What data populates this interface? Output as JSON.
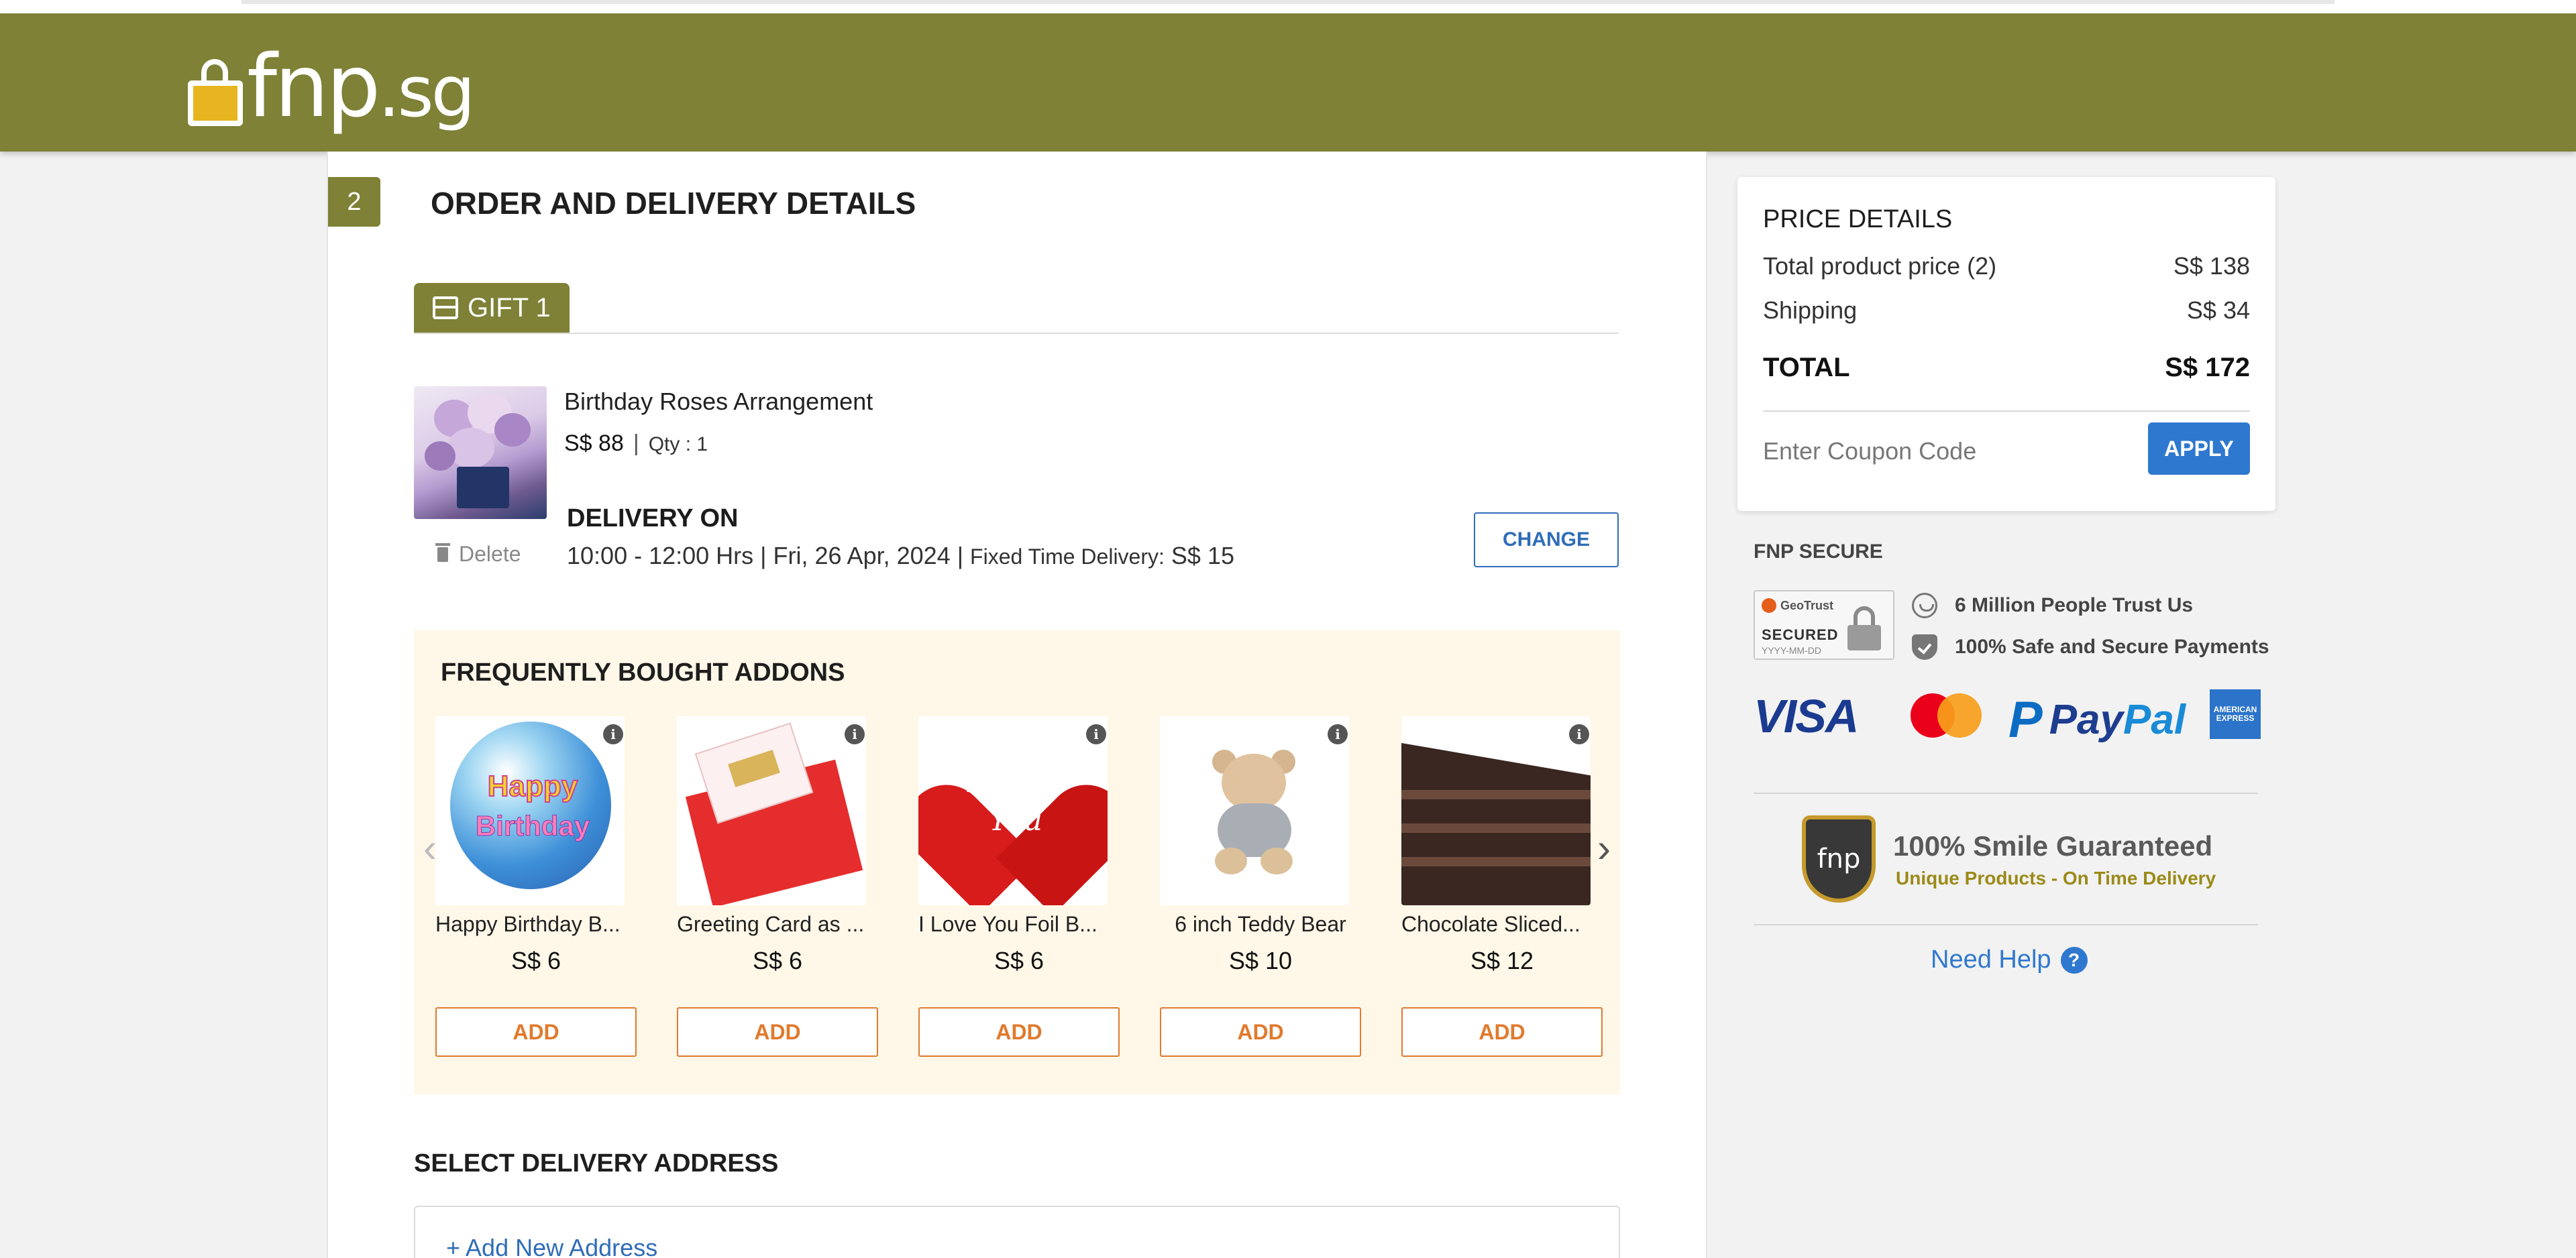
{
  "brand": {
    "logo_text": "fnp",
    "logo_suffix": ".sg",
    "header_color": "#7e8136"
  },
  "order": {
    "step_number": "2",
    "section_title": "ORDER AND DELIVERY DETAILS",
    "gift_tab_label": "GIFT 1",
    "product": {
      "name": "Birthday Roses Arrangement",
      "price": "S$ 88",
      "qty": "Qty : 1",
      "delete_label": "Delete"
    },
    "delivery": {
      "title": "DELIVERY ON",
      "slot": "10:00 - 12:00 Hrs",
      "date": "Fri, 26 Apr, 2024",
      "type_label": "Fixed Time Delivery:",
      "fee": "S$ 15",
      "change_label": "CHANGE"
    }
  },
  "addons": {
    "title": "FREQUENTLY BOUGHT ADDONS",
    "add_label": "ADD",
    "items": [
      {
        "name": "Happy Birthday B...",
        "price": "S$ 6"
      },
      {
        "name": "Greeting Card as ...",
        "price": "S$ 6"
      },
      {
        "name": "I Love You Foil B...",
        "price": "S$ 6"
      },
      {
        "name": "6 inch Teddy Bear",
        "price": "S$ 10"
      },
      {
        "name": "Chocolate Sliced...",
        "price": "S$ 12"
      }
    ]
  },
  "address": {
    "title": "SELECT DELIVERY ADDRESS",
    "add_new": "+ Add New Address"
  },
  "price_details": {
    "title": "PRICE DETAILS",
    "total_product_label": "Total product price (2)",
    "total_product_value": "S$ 138",
    "shipping_label": "Shipping",
    "shipping_value": "S$ 34",
    "total_label": "TOTAL",
    "total_value": "S$ 172",
    "coupon_placeholder": "Enter Coupon Code",
    "apply_label": "APPLY"
  },
  "secure": {
    "title": "FNP SECURE",
    "geotrust_brand": "GeoTrust",
    "geotrust_secured": "SECURED",
    "geotrust_date": "YYYY-MM-DD",
    "trust_1": "6 Million People Trust Us",
    "trust_2": "100% Safe and Secure Payments",
    "visa": "VISA",
    "paypal_pay": "Pay",
    "paypal_pal": "Pal",
    "amex": "AMERICAN EXPRESS"
  },
  "guarantee": {
    "badge_text": "fnp",
    "title": "100% Smile Guaranteed",
    "subtitle": "Unique Products - On Time Delivery"
  },
  "help": {
    "label": "Need Help",
    "icon": "?"
  }
}
